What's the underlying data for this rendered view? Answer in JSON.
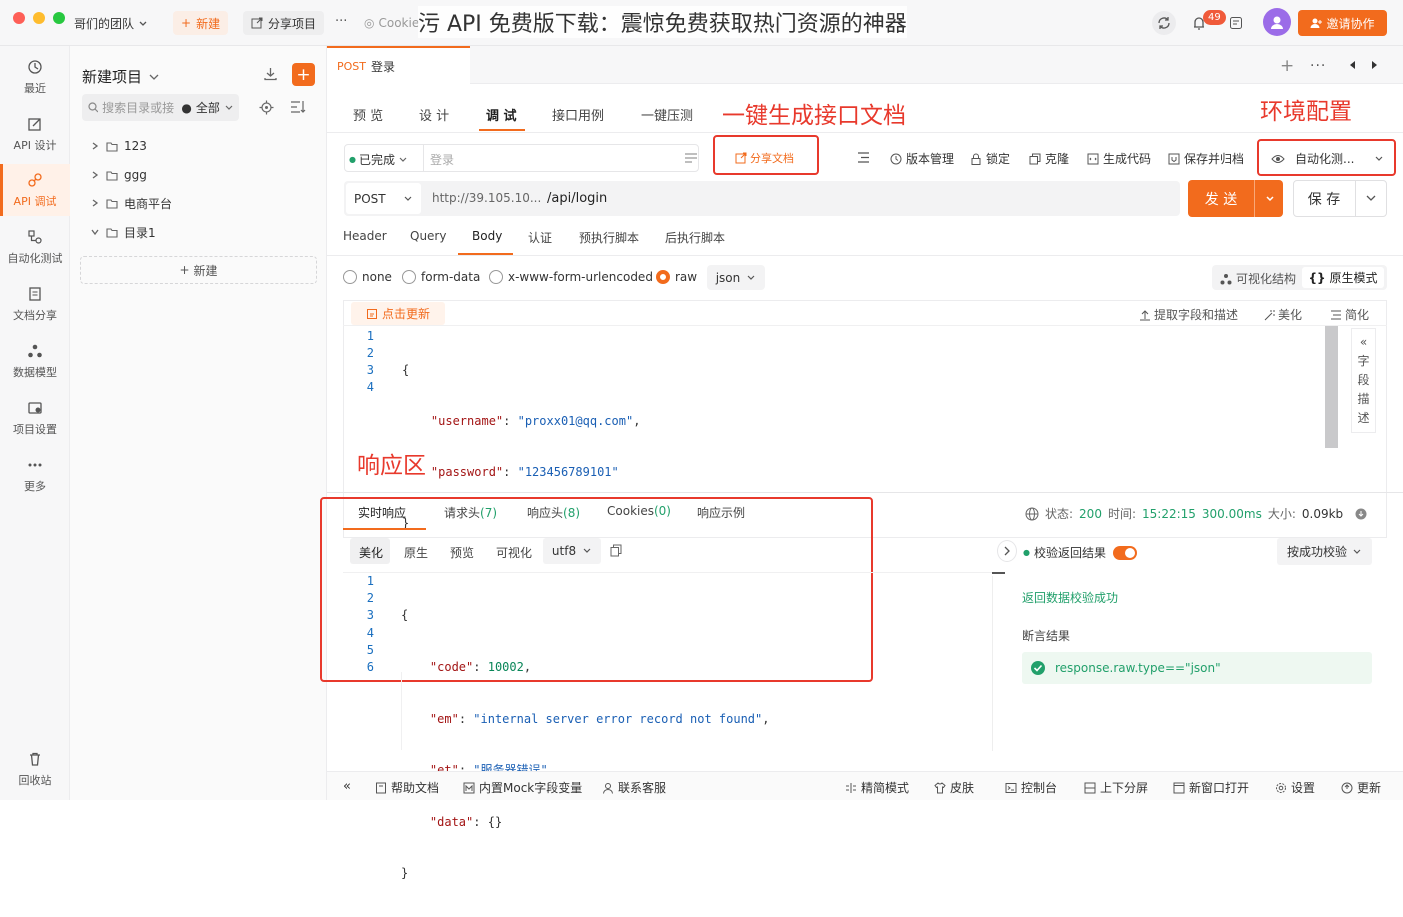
{
  "overlay_title": "污 API 免费版下载：震惊免费获取热门资源的神器",
  "titlebar": {
    "team": "哥们的团队",
    "new_btn": "新建",
    "share_btn": "分享项目",
    "more": "···",
    "cookie_tab": "Cookie",
    "notif_count": "49",
    "invite_btn": "邀请协作"
  },
  "leftnav": [
    {
      "label": "最近",
      "icon": "clock-icon"
    },
    {
      "label": "API 设计",
      "icon": "design-icon"
    },
    {
      "label": "API 调试",
      "icon": "debug-icon"
    },
    {
      "label": "自动化测试",
      "icon": "automation-icon"
    },
    {
      "label": "文档分享",
      "icon": "doc-icon"
    },
    {
      "label": "数据模型",
      "icon": "model-icon"
    },
    {
      "label": "项目设置",
      "icon": "settings-icon"
    },
    {
      "label": "更多",
      "icon": "more-icon"
    },
    {
      "label": "回收站",
      "icon": "trash-icon"
    }
  ],
  "tree": {
    "title": "新建项目",
    "search_placeholder": "搜索目录或接口",
    "filter": "全部",
    "items": [
      "123",
      "ggg",
      "电商平台",
      "目录1"
    ],
    "new_label": "新建"
  },
  "request_tab": {
    "method": "POST",
    "name": "登录"
  },
  "main_tabs": [
    "预 览",
    "设 计",
    "调 试",
    "接口用例",
    "一键压测"
  ],
  "annotations": {
    "gen_doc": "一键生成接口文档",
    "env": "环境配置",
    "response": "响应区"
  },
  "toolbar": {
    "status": "已完成",
    "name_placeholder": "登录",
    "share_doc": "分享文档",
    "version": "版本管理",
    "lock": "锁定",
    "clone": "克隆",
    "gen_code": "生成代码",
    "save_archive": "保存并归档",
    "env_select": "自动化测..."
  },
  "url_bar": {
    "method": "POST",
    "host": "http://39.105.10...",
    "path": "/api/login",
    "send": "发 送",
    "save": "保 存"
  },
  "param_tabs": [
    "Header",
    "Query",
    "Body",
    "认证",
    "预执行脚本",
    "后执行脚本"
  ],
  "body_types": [
    "none",
    "form-data",
    "x-www-form-urlencoded",
    "raw"
  ],
  "raw_format": "json",
  "view_modes": {
    "visual": "可视化结构",
    "raw": "原生模式"
  },
  "editor_toolbar": {
    "refresh": "点击更新",
    "extract": "提取字段和描述",
    "beautify": "美化",
    "simplify": "简化",
    "side_label": "字段描述"
  },
  "request_body": {
    "line_numbers": [
      "1",
      "2",
      "3",
      "4"
    ],
    "open": "{",
    "username_key": "\"username\"",
    "username_val": "\"proxx01@qq.com\"",
    "password_key": "\"password\"",
    "password_val": "\"123456789101\"",
    "close": "}"
  },
  "response_tabs": {
    "realtime": "实时响应",
    "req_headers": "请求头",
    "req_headers_count": "(7)",
    "resp_headers": "响应头",
    "resp_headers_count": "(8)",
    "cookies": "Cookies",
    "cookies_count": "(0)",
    "example": "响应示例"
  },
  "response_status": {
    "status_label": "状态:",
    "status": "200",
    "time_label": "时间:",
    "time": "15:22:15",
    "duration": "300.00ms",
    "size_label": "大小:",
    "size": "0.09kb"
  },
  "response_views": [
    "美化",
    "原生",
    "预览",
    "可视化"
  ],
  "encoding": "utf8",
  "response_body": {
    "line_numbers": [
      "1",
      "2",
      "3",
      "4",
      "5",
      "6"
    ],
    "open": "{",
    "code_key": "\"code\"",
    "code_val": "10002",
    "em_key": "\"em\"",
    "em_val": "\"internal server error record not found\"",
    "et_key": "\"et\"",
    "et_val": "\"服务器错误\"",
    "data_key": "\"data\"",
    "data_val": "{}",
    "close": "}"
  },
  "validation": {
    "toggle_label": "校验返回结果",
    "mode": "按成功校验",
    "success": "返回数据校验成功",
    "assert_title": "断言结果",
    "assert_item": "response.raw.type==\"json\""
  },
  "bottombar": {
    "help": "帮助文档",
    "mock": "内置Mock字段变量",
    "contact": "联系客服",
    "compact": "精简模式",
    "skin": "皮肤",
    "console": "控制台",
    "split": "上下分屏",
    "new_window": "新窗口打开",
    "settings": "设置",
    "update": "更新"
  },
  "colors": {
    "accent": "#f26b1d",
    "annotation": "#e8392c",
    "success": "#22a06b"
  }
}
